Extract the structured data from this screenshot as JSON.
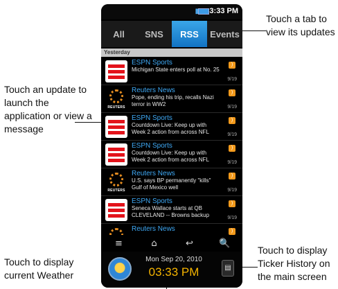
{
  "callouts": {
    "tab": "Touch a tab to view its updates",
    "update": "Touch an update to launch the application or view a message",
    "weather": "Touch to display current Weather",
    "ticker": "Touch to display Ticker History on the main screen"
  },
  "status_bar": {
    "time": "3:33 PM"
  },
  "tabs": [
    {
      "label": "All",
      "active": false
    },
    {
      "label": "SNS",
      "active": false
    },
    {
      "label": "RSS",
      "active": true
    },
    {
      "label": "Events",
      "active": false
    }
  ],
  "section_label": "Yesterday",
  "items": [
    {
      "source": "ESPN Sports",
      "text": "Michigan State enters poll at No. 25",
      "date": "9/19",
      "thumb": "espn-logo-icon"
    },
    {
      "source": "Reuters News",
      "text": "Pope, ending his trip, recalls Nazi terror in WW2",
      "date": "9/19",
      "thumb": "reuters-logo-icon"
    },
    {
      "source": "ESPN Sports",
      "text": "Countdown Live: Keep up with Week 2 action from across NFL",
      "date": "9/19",
      "thumb": "espn-logo-icon"
    },
    {
      "source": "ESPN Sports",
      "text": "Countdown Live: Keep up with Week 2 action from across NFL",
      "date": "9/19",
      "thumb": "espn-logo-icon"
    },
    {
      "source": "Reuters News",
      "text": "U.S. says BP permanently \"kills\" Gulf of Mexico well",
      "date": "9/19",
      "thumb": "reuters-logo-icon"
    },
    {
      "source": "ESPN Sports",
      "text": "Seneca Wallace starts at QB CLEVELAND -- Browns backup",
      "date": "9/19",
      "thumb": "espn-logo-icon"
    },
    {
      "source": "Reuters News",
      "text": "",
      "date": "",
      "thumb": "reuters-logo-icon"
    }
  ],
  "reuters_logo_text": "REUTERS",
  "nav": {
    "menu": "≡",
    "home": "⌂",
    "back": "↩",
    "search": "🔍"
  },
  "bottom": {
    "date": "Mon Sep 20, 2010",
    "time": "03:33 PM"
  },
  "colors": {
    "accent": "#1a8ee0",
    "espn_red": "#e3131b",
    "reuters_orange": "#e58d21",
    "time_yellow": "#f5b400"
  }
}
